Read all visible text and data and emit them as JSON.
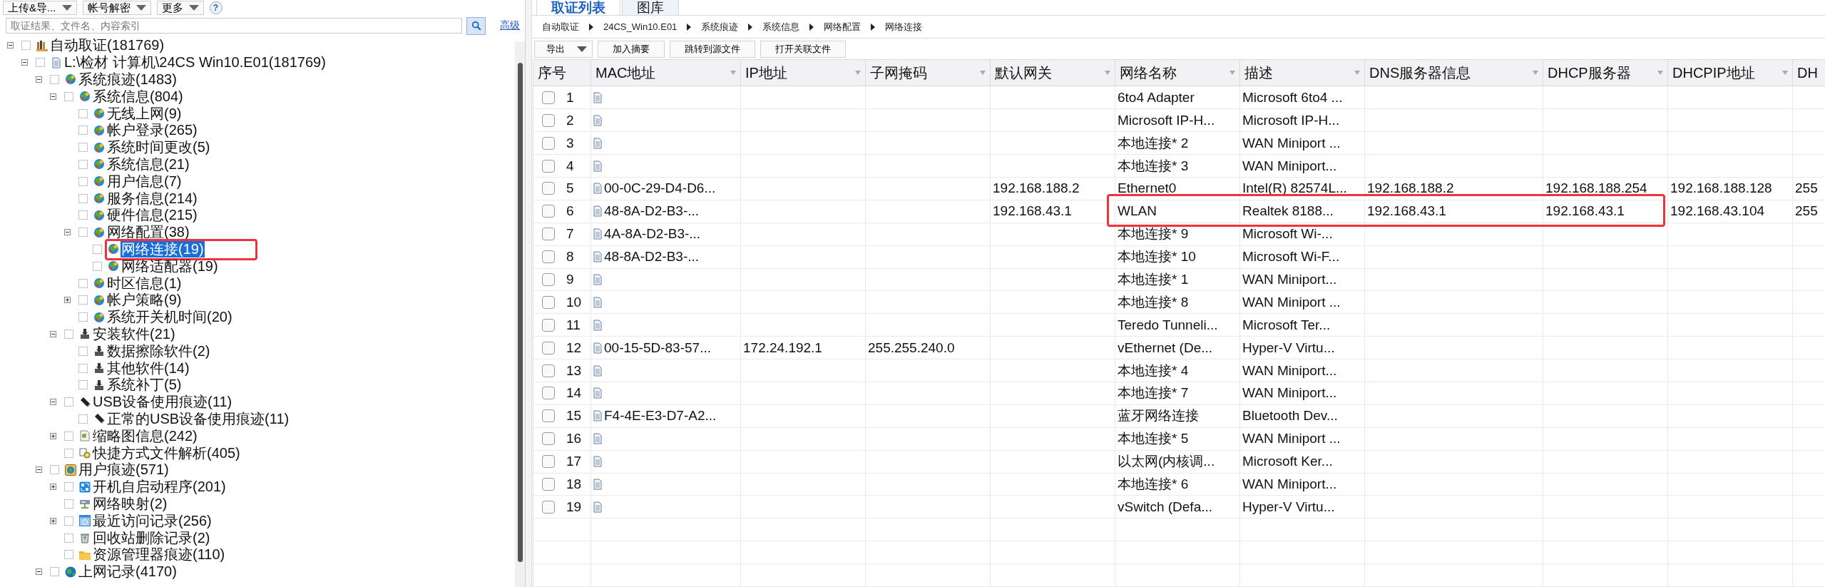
{
  "left_toolbar": {
    "buttons": [
      {
        "label": "上传&导...",
        "dropdown": true
      },
      {
        "label": "帐号解密",
        "dropdown": true
      },
      {
        "label": "更多",
        "dropdown": true
      }
    ],
    "help": "?"
  },
  "search": {
    "placeholder": "取证结果、文件名、内容索引",
    "advanced_link": "高级"
  },
  "tree": {
    "items": [
      {
        "label": "自动取证(181769)",
        "kind": "forensics",
        "checked": false,
        "selected": false,
        "highlighted": false,
        "expanded": true,
        "children": [
          {
            "label": "L:\\检材 计算机\\24CS  Win10.E01(181769)",
            "kind": "evidence",
            "checked": false,
            "selected": false,
            "highlighted": false,
            "expanded": true,
            "children": [
              {
                "label": "系统痕迹(1483)",
                "kind": "trace",
                "checked": false,
                "selected": false,
                "highlighted": false,
                "expanded": true,
                "children": [
                  {
                    "label": "系统信息(804)",
                    "kind": "trace",
                    "checked": false,
                    "selected": false,
                    "highlighted": false,
                    "expanded": true,
                    "children": [
                      {
                        "label": "无线上网(9)",
                        "kind": "trace",
                        "checked": false,
                        "selected": false,
                        "highlighted": false
                      },
                      {
                        "label": "帐户登录(265)",
                        "kind": "trace",
                        "checked": false,
                        "selected": false,
                        "highlighted": false
                      },
                      {
                        "label": "系统时间更改(5)",
                        "kind": "trace",
                        "checked": false,
                        "selected": false,
                        "highlighted": false
                      },
                      {
                        "label": "系统信息(21)",
                        "kind": "trace",
                        "checked": false,
                        "selected": false,
                        "highlighted": false
                      },
                      {
                        "label": "用户信息(7)",
                        "kind": "trace",
                        "checked": false,
                        "selected": false,
                        "highlighted": false
                      },
                      {
                        "label": "服务信息(214)",
                        "kind": "trace",
                        "checked": false,
                        "selected": false,
                        "highlighted": false
                      },
                      {
                        "label": "硬件信息(215)",
                        "kind": "trace",
                        "checked": false,
                        "selected": false,
                        "highlighted": false
                      },
                      {
                        "label": "网络配置(38)",
                        "kind": "trace",
                        "checked": false,
                        "selected": false,
                        "highlighted": false,
                        "expanded": true,
                        "children": [
                          {
                            "label": "网络连接(19)",
                            "kind": "trace",
                            "checked": false,
                            "selected": true,
                            "highlighted": true
                          },
                          {
                            "label": "网络适配器(19)",
                            "kind": "trace",
                            "checked": false,
                            "selected": false,
                            "highlighted": false
                          }
                        ]
                      },
                      {
                        "label": "时区信息(1)",
                        "kind": "trace",
                        "checked": false,
                        "selected": false,
                        "highlighted": false
                      },
                      {
                        "label": "帐户策略(9)",
                        "kind": "trace",
                        "checked": false,
                        "selected": false,
                        "highlighted": false,
                        "expanded": false
                      },
                      {
                        "label": "系统开关机时间(20)",
                        "kind": "trace",
                        "checked": false,
                        "selected": false,
                        "highlighted": false
                      }
                    ]
                  },
                  {
                    "label": "安装软件(21)",
                    "kind": "installer",
                    "checked": false,
                    "selected": false,
                    "highlighted": false,
                    "expanded": true,
                    "children": [
                      {
                        "label": "数据擦除软件(2)",
                        "kind": "installer",
                        "checked": false,
                        "selected": false,
                        "highlighted": false
                      },
                      {
                        "label": "其他软件(14)",
                        "kind": "installer",
                        "checked": false,
                        "selected": false,
                        "highlighted": false
                      },
                      {
                        "label": "系统补丁(5)",
                        "kind": "installer",
                        "checked": false,
                        "selected": false,
                        "highlighted": false
                      }
                    ]
                  },
                  {
                    "label": "USB设备使用痕迹(11)",
                    "kind": "usb",
                    "checked": false,
                    "selected": false,
                    "highlighted": false,
                    "expanded": true,
                    "children": [
                      {
                        "label": "正常的USB设备使用痕迹(11)",
                        "kind": "usb",
                        "checked": false,
                        "selected": false,
                        "highlighted": false
                      }
                    ]
                  },
                  {
                    "label": "缩略图信息(242)",
                    "kind": "thumbnail",
                    "checked": false,
                    "selected": false,
                    "highlighted": false,
                    "expanded": false
                  },
                  {
                    "label": "快捷方式文件解析(405)",
                    "kind": "shortcut",
                    "checked": false,
                    "selected": false,
                    "highlighted": false
                  }
                ]
              },
              {
                "label": "用户痕迹(571)",
                "kind": "user",
                "checked": false,
                "selected": false,
                "highlighted": false,
                "expanded": true,
                "children": [
                  {
                    "label": "开机自启动程序(201)",
                    "kind": "startup",
                    "checked": false,
                    "selected": false,
                    "highlighted": false,
                    "expanded": false
                  },
                  {
                    "label": "网络映射(2)",
                    "kind": "netmap",
                    "checked": false,
                    "selected": false,
                    "highlighted": false
                  },
                  {
                    "label": "最近访问记录(256)",
                    "kind": "recent",
                    "checked": false,
                    "selected": false,
                    "highlighted": false,
                    "expanded": false
                  },
                  {
                    "label": "回收站删除记录(2)",
                    "kind": "recycle",
                    "checked": false,
                    "selected": false,
                    "highlighted": false
                  },
                  {
                    "label": "资源管理器痕迹(110)",
                    "kind": "folder",
                    "checked": false,
                    "selected": false,
                    "highlighted": false
                  }
                ]
              },
              {
                "label": "上网记录(4170)",
                "kind": "globe",
                "checked": false,
                "selected": false,
                "highlighted": false,
                "expanded": true
              }
            ]
          }
        ]
      }
    ]
  },
  "tabs": [
    {
      "label": "取证列表",
      "selected": true
    },
    {
      "label": "图库",
      "selected": false
    }
  ],
  "breadcrumb": [
    "自动取证",
    "24CS_Win10.E01",
    "系统痕迹",
    "系统信息",
    "网络配置",
    "网络连接"
  ],
  "table_toolbar": [
    {
      "label": "导出",
      "dropdown": true
    },
    {
      "label": "加入摘要",
      "dropdown": false
    },
    {
      "label": "跳转到源文件",
      "dropdown": false
    },
    {
      "label": "打开关联文件",
      "dropdown": false
    }
  ],
  "table": {
    "columns": [
      {
        "label": "序号",
        "filter": false
      },
      {
        "label": "MAC地址",
        "filter": true
      },
      {
        "label": "IP地址",
        "filter": true
      },
      {
        "label": "子网掩码",
        "filter": true
      },
      {
        "label": "默认网关",
        "filter": true
      },
      {
        "label": "网络名称",
        "filter": true
      },
      {
        "label": "描述",
        "filter": true
      },
      {
        "label": "DNS服务器信息",
        "filter": true
      },
      {
        "label": "DHCP服务器",
        "filter": true
      },
      {
        "label": "DHCPIP地址",
        "filter": true
      },
      {
        "label": "DH"
      }
    ],
    "rows": [
      {
        "no": "1",
        "checked": false,
        "highlighted": false,
        "name": "6to4 Adapter",
        "desc": "Microsoft 6to4 ..."
      },
      {
        "no": "2",
        "checked": false,
        "highlighted": false,
        "name": "Microsoft IP-H...",
        "desc": "Microsoft IP-H..."
      },
      {
        "no": "3",
        "checked": false,
        "highlighted": false,
        "name": "本地连接* 2",
        "desc": "WAN Miniport ..."
      },
      {
        "no": "4",
        "checked": false,
        "highlighted": false,
        "name": "本地连接* 3",
        "desc": "WAN Miniport..."
      },
      {
        "no": "5",
        "checked": false,
        "highlighted": false,
        "mac": "00-0C-29-D4-D6...",
        "gateway": "192.168.188.2",
        "name": "Ethernet0",
        "desc": "Intel(R) 82574L...",
        "dns": "192.168.188.2",
        "dhcp": "192.168.188.254",
        "dhcp_ip": "192.168.188.128",
        "column_11": "255"
      },
      {
        "no": "6",
        "checked": false,
        "highlighted": true,
        "mac": "48-8A-D2-B3-...",
        "gateway": "192.168.43.1",
        "name": "WLAN",
        "desc": "Realtek 8188...",
        "dns": "192.168.43.1",
        "dhcp": "192.168.43.1",
        "dhcp_ip": "192.168.43.104",
        "column_11": "255"
      },
      {
        "no": "7",
        "checked": false,
        "highlighted": false,
        "mac": "4A-8A-D2-B3-...",
        "name": "本地连接* 9",
        "desc": "Microsoft Wi-..."
      },
      {
        "no": "8",
        "checked": false,
        "highlighted": false,
        "mac": "48-8A-D2-B3-...",
        "name": "本地连接* 10",
        "desc": "Microsoft Wi-F..."
      },
      {
        "no": "9",
        "checked": false,
        "highlighted": false,
        "name": "本地连接* 1",
        "desc": "WAN Miniport..."
      },
      {
        "no": "10",
        "checked": false,
        "highlighted": false,
        "name": "本地连接* 8",
        "desc": "WAN Miniport ..."
      },
      {
        "no": "11",
        "checked": false,
        "highlighted": false,
        "name": "Teredo Tunneli...",
        "desc": "Microsoft Ter..."
      },
      {
        "no": "12",
        "checked": false,
        "highlighted": false,
        "mac": "00-15-5D-83-57...",
        "ip": "172.24.192.1",
        "subnet": "255.255.240.0",
        "name": "vEthernet (De...",
        "desc": "Hyper-V Virtu..."
      },
      {
        "no": "13",
        "checked": false,
        "highlighted": false,
        "name": "本地连接* 4",
        "desc": "WAN Miniport..."
      },
      {
        "no": "14",
        "checked": false,
        "highlighted": false,
        "name": "本地连接* 7",
        "desc": "WAN Miniport..."
      },
      {
        "no": "15",
        "checked": false,
        "highlighted": false,
        "mac": "F4-4E-E3-D7-A2...",
        "name": "蓝牙网络连接",
        "desc": "Bluetooth Dev..."
      },
      {
        "no": "16",
        "checked": false,
        "highlighted": false,
        "name": "本地连接* 5",
        "desc": "WAN Miniport ..."
      },
      {
        "no": "17",
        "checked": false,
        "highlighted": false,
        "name": "以太网(内核调...",
        "desc": "Microsoft Ker..."
      },
      {
        "no": "18",
        "checked": false,
        "highlighted": false,
        "name": "本地连接* 6",
        "desc": "WAN Miniport..."
      },
      {
        "no": "19",
        "checked": false,
        "highlighted": false,
        "name": "vSwitch (Defa...",
        "desc": "Hyper-V Virtu..."
      }
    ]
  }
}
